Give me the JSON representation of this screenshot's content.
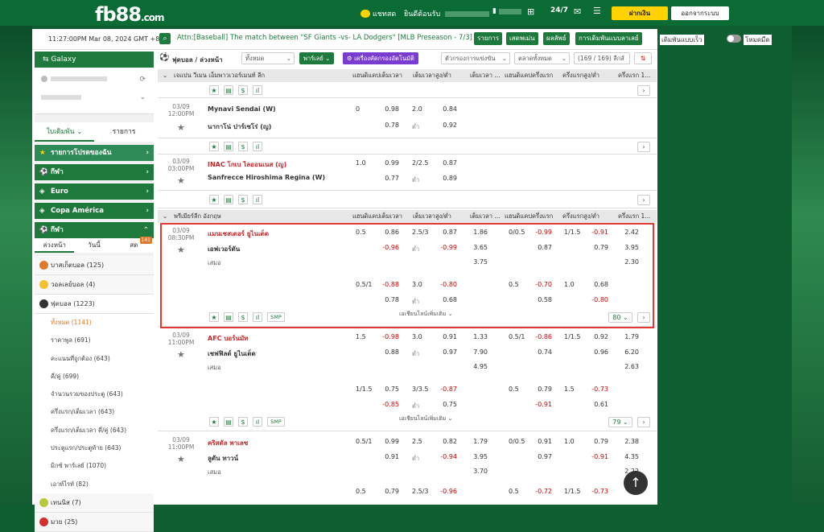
{
  "header": {
    "logo": "fb88",
    "logo_suffix": ".com",
    "chat": "แชทสด",
    "welcome": "ยินดีต้อนรับ",
    "deposit": "ฝากเงิน",
    "logout": "ออกจากระบบ"
  },
  "ticker": {
    "time": "11:27:00PM Mar 08, 2024 GMT +8",
    "message": "Attn:[Baseball] The match between \"SF Giants -vs- LA Dodgers\" [MLB Preseason - 7/3] has",
    "btn1": "รายการ",
    "btn2": "เสดพเม่น",
    "btn3": "ผลลัพธ์",
    "btn4": "การเดิมพันแบบลาเลย์",
    "toggle1": "เดิมพันแบบเร็ว",
    "toggle2": "โหมดมืด"
  },
  "sidebar": {
    "galaxy": "Galaxy",
    "tab_active": "ใบเดิมพัน",
    "tab_other": "รายการ",
    "sections": [
      "รายการโปรดของฉัน",
      "กีฬา",
      "Euro",
      "Copa América",
      "กีฬา"
    ],
    "sub": [
      "ล่วงหน้า",
      "วันนี้",
      "สด"
    ],
    "live_count": "141",
    "sports": [
      {
        "name": "บาสเก็ตบอล",
        "count": "(125)",
        "color": "#e07a2e"
      },
      {
        "name": "วอลเลย์บอล",
        "count": "(4)",
        "color": "#f2c230"
      },
      {
        "name": "ฟุตบอล",
        "count": "(1223)",
        "color": "#333333"
      }
    ],
    "items": [
      "ทั้งหมด (1141)",
      "ราคาพูล (691)",
      "คะแนนที่ถูกต้อง (643)",
      "คี่/คู่ (699)",
      "จำนวนรวมของประตู (643)",
      "ครึ่งแรก/เต็มเวลา (643)",
      "ครึ่งแรก/เต็มเวลา คี่/คู่ (643)",
      "ประตูแรก/ประตูท้าย (643)",
      "มิกซ์ พาร์เลย์ (1070)",
      "เอาท์ไรท์ (82)"
    ],
    "tennis": {
      "name": "เทนนิส",
      "count": "(7)"
    },
    "muay": {
      "name": "มวย",
      "count": "(25)"
    }
  },
  "filters": {
    "title": "ฟุตบอล / ล่วงหน้า",
    "all": "ทั้งหมด",
    "parlay": "พาร์เลย์",
    "custom": "เครื่องคัดกรองอัตโนมัติ",
    "league_filter": "ตัวกรองการแข่งขัน",
    "market": "ตลาดทั้งหมด",
    "count": "(169 / 169) ลีกส์"
  },
  "columns": {
    "hdp": "แฮนดิแคปเต็มเวลา",
    "ou": "เต็มเวลาสูง/ต่ำ",
    "x12": "เต็มเวลา ...",
    "hdp1h": "แฮนดิแคปครึ่งแรก",
    "ou1h": "ครึ่งแรกสูง/ต่ำ",
    "x121h": "ครึ่งแรก 1..."
  },
  "league1": "เจแปน วีเมน เอ็มพาวเวอร์เมนท์ ลีก",
  "league2": "พรีเมียร์ลีก อังกฤษ",
  "matches": [
    {
      "date": "03/09",
      "time": "12:00PM",
      "home": "Mynavi Sendai (W)",
      "away": "นากาโน่ ปาร์เซโร่ (ญ)",
      "h1": "0",
      "o1": "0.98",
      "o2": "0.78",
      "g1": "2.0",
      "u1": "0.84",
      "lb": "ต่ำ",
      "u2": "0.92"
    },
    {
      "date": "03/09",
      "time": "03:00PM",
      "home": "INAC โกเบ ไลออนเนส (ญ)",
      "away": "Sanfrecce Hiroshima Regina (W)",
      "h1": "1.0",
      "o1": "0.99",
      "o2": "0.77",
      "g1": "2/2.5",
      "u1": "0.87",
      "lb": "ต่ำ",
      "u2": "0.89"
    },
    {
      "date": "03/09",
      "time": "08:30PM",
      "home": "แมนเชสเตอร์ ยูไนเต็ด",
      "away": "เอฟเวอร์ตัน",
      "draw": "เสมอ",
      "r1": {
        "h": "0.5",
        "a": "0.86",
        "b": "-0.96",
        "g": "2.5/3",
        "u": "0.87",
        "lb": "ต่ำ",
        "v": "-0.99",
        "x1": "1.86",
        "x2": "3.65",
        "x3": "3.75",
        "h1h": "0/0.5",
        "a1h": "-0.99",
        "b1h": "0.87",
        "g1h": "1/1.5",
        "u1h": "-0.91",
        "v1h": "0.79",
        "y1": "2.42",
        "y2": "3.95",
        "y3": "2.30"
      },
      "r2": {
        "h": "0.5/1",
        "a": "-0.88",
        "b": "0.78",
        "g": "3.0",
        "u": "-0.80",
        "lb": "ต่ำ",
        "v": "0.68",
        "h1h": "0.5",
        "a1h": "-0.70",
        "b1h": "0.58",
        "g1h": "1.0",
        "u1h": "0.68",
        "v1h": "-0.80"
      },
      "more": "เอเชียนไลน์เพิ่มเติม",
      "extra": "80"
    },
    {
      "date": "03/09",
      "time": "11:00PM",
      "home": "AFC บอร์นมัท",
      "away": "เชฟฟิลด์ ยูไนเต็ด",
      "draw": "เสมอ",
      "r1": {
        "h": "1.5",
        "a": "-0.98",
        "b": "0.88",
        "g": "3.0",
        "u": "0.91",
        "lb": "ต่ำ",
        "v": "0.97",
        "x1": "1.33",
        "x2": "7.90",
        "x3": "4.95",
        "h1h": "0.5/1",
        "a1h": "-0.86",
        "b1h": "0.74",
        "g1h": "1/1.5",
        "u1h": "0.92",
        "v1h": "0.96",
        "y1": "1.79",
        "y2": "6.20",
        "y3": "2.63"
      },
      "r2": {
        "h": "1/1.5",
        "a": "0.75",
        "b": "-0.85",
        "g": "3/3.5",
        "u": "-0.87",
        "lb": "ต่ำ",
        "v": "0.75",
        "h1h": "0.5",
        "a1h": "0.79",
        "b1h": "-0.91",
        "g1h": "1.5",
        "u1h": "-0.73",
        "v1h": "0.61"
      },
      "more": "เอเชียนไลน์เพิ่มเติม",
      "extra": "79"
    },
    {
      "date": "03/09",
      "time": "11:00PM",
      "home": "คริสตัล พาเลซ",
      "away": "ลูตัน ทาวน์",
      "draw": "เสมอ",
      "r1": {
        "h": "0.5/1",
        "a": "0.99",
        "b": "0.91",
        "g": "2.5",
        "u": "0.82",
        "lb": "ต่ำ",
        "v": "-0.94",
        "x1": "1.79",
        "x2": "3.95",
        "x3": "3.70",
        "h1h": "0/0.5",
        "a1h": "0.91",
        "b1h": "0.97",
        "g1h": "1.0",
        "u1h": "0.79",
        "v1h": "-0.91",
        "y1": "2.38",
        "y2": "4.35",
        "y3": "2.22"
      },
      "r2": {
        "h": "0.5",
        "a": "0.79",
        "g": "2.5/3",
        "u": "-0.96",
        "h1h": "0.5",
        "a1h": "-0.72",
        "g1h": "1/1.5",
        "u1h": "-0.73"
      }
    }
  ],
  "smp": "SMP"
}
